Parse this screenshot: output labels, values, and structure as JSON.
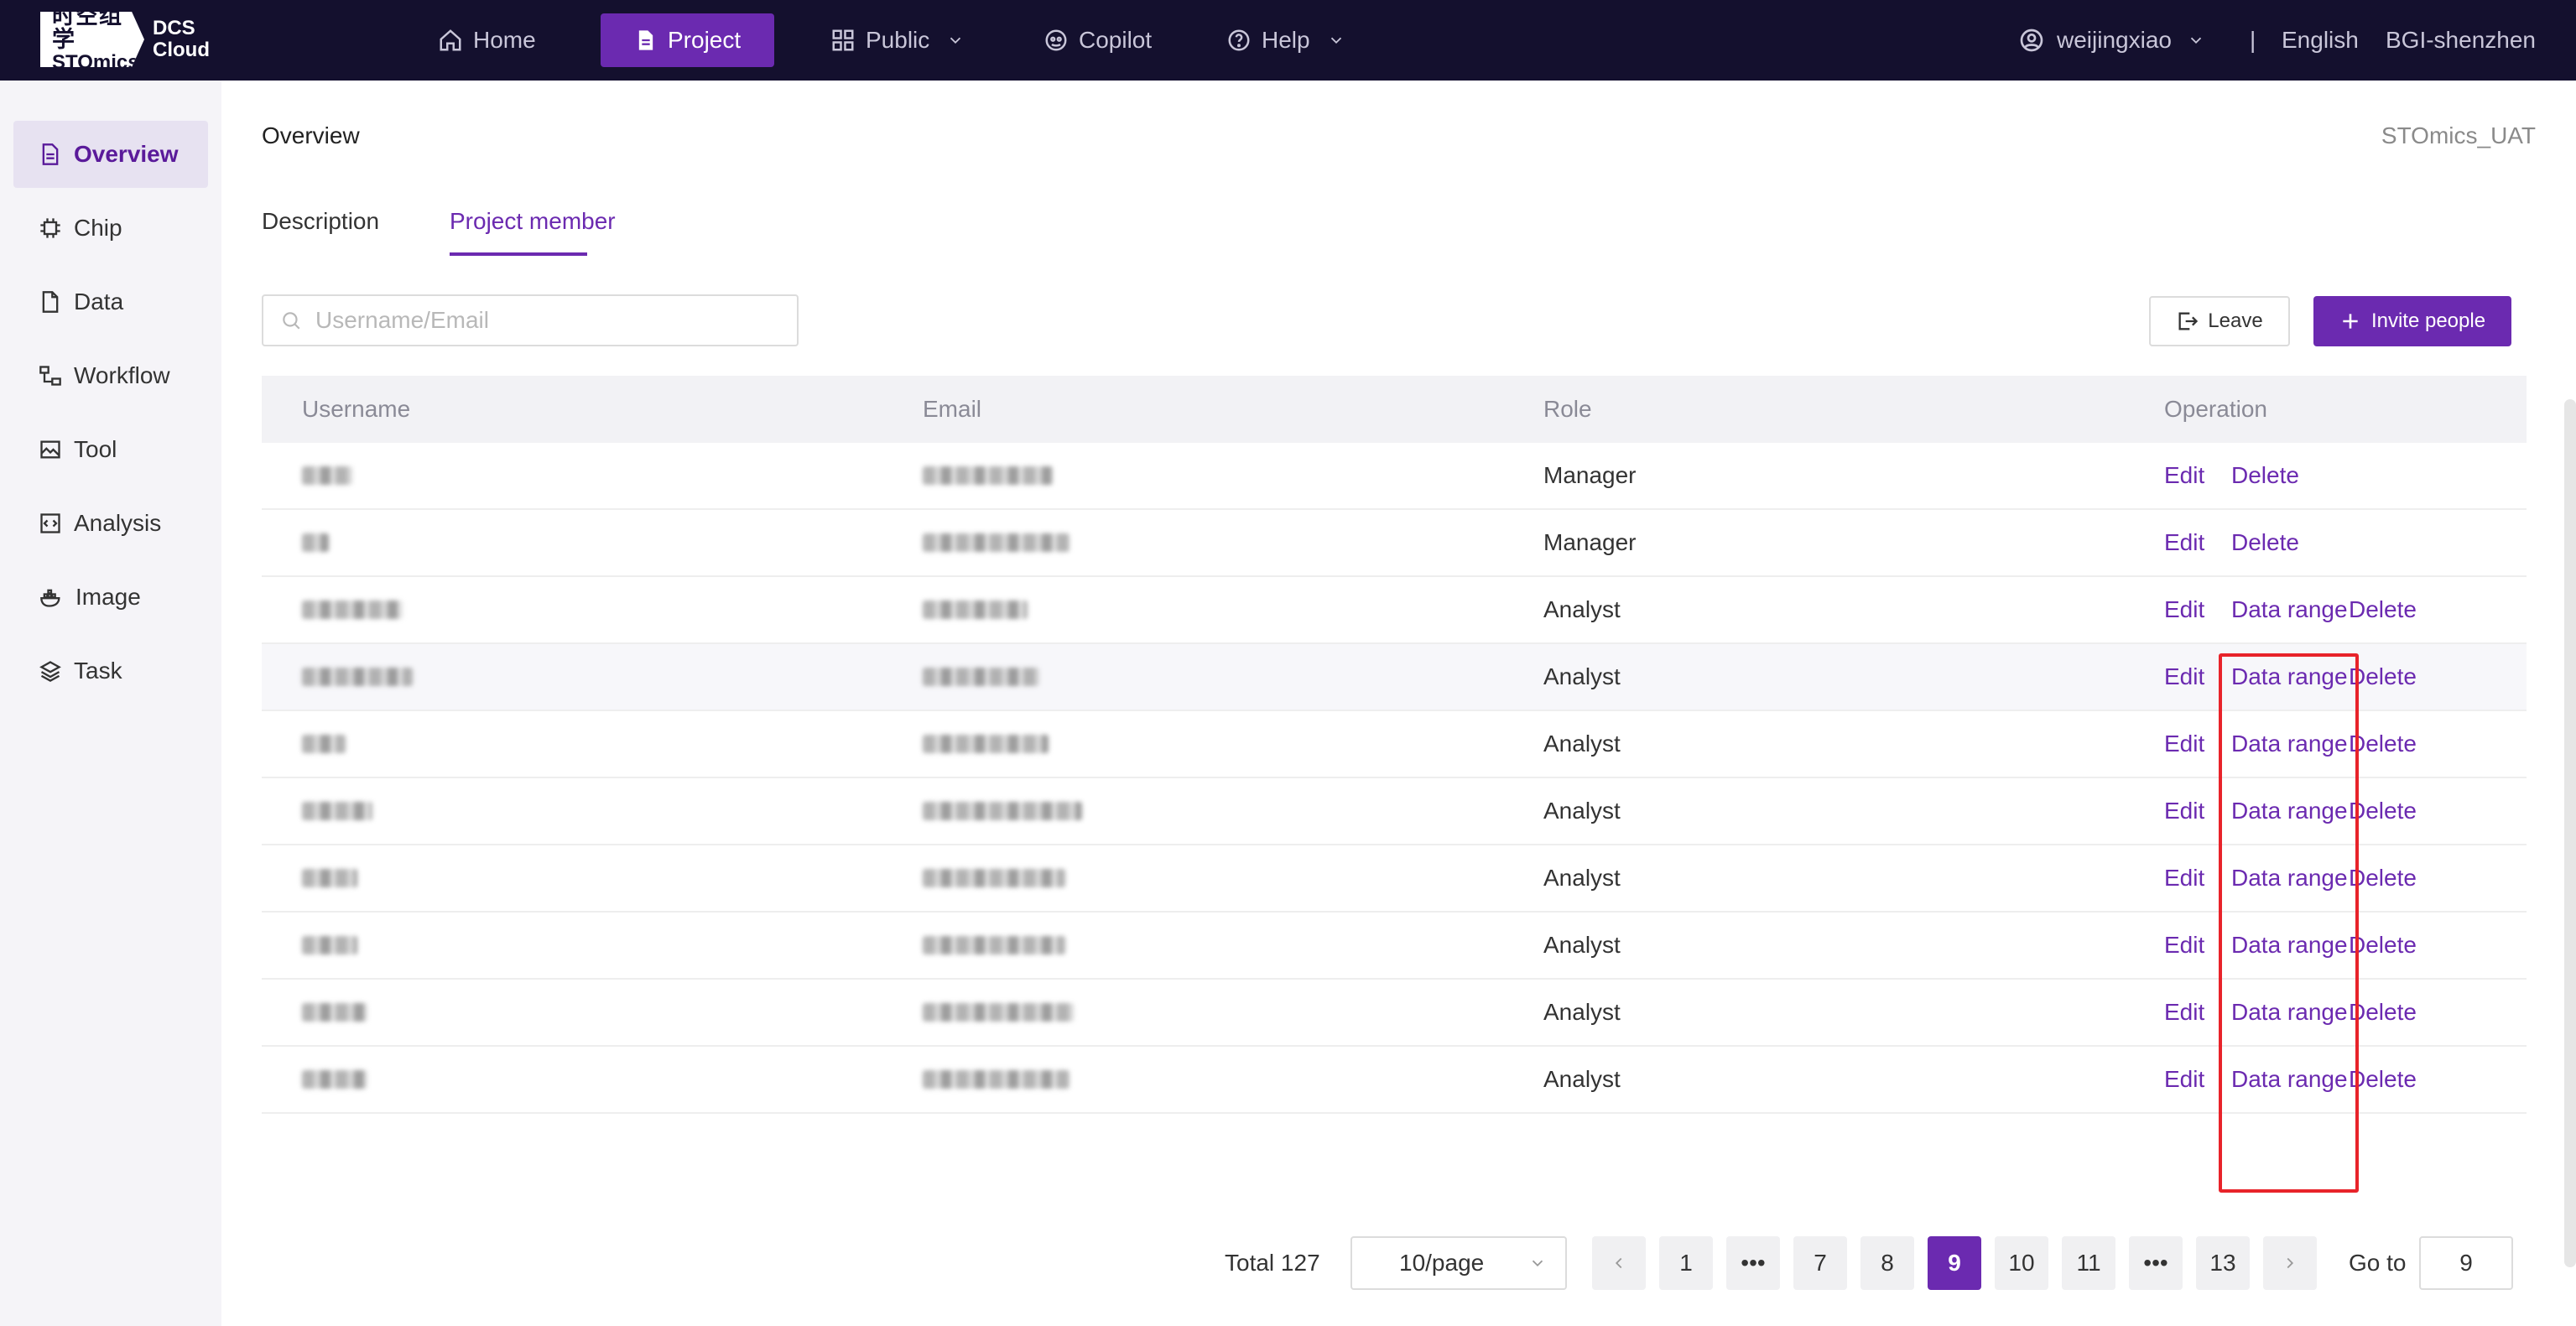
{
  "brand": {
    "logo_cn": "时空组学",
    "logo_en": "STOmics",
    "product_line1": "DCS",
    "product_line2": "Cloud"
  },
  "topnav": [
    {
      "label": "Home",
      "icon": "home-icon"
    },
    {
      "label": "Project",
      "icon": "document-icon",
      "active": true
    },
    {
      "label": "Public",
      "icon": "grid-icon",
      "dropdown": true
    },
    {
      "label": "Copilot",
      "icon": "copilot-icon"
    },
    {
      "label": "Help",
      "icon": "help-icon",
      "dropdown": true
    }
  ],
  "user": {
    "name": "weijingxiao",
    "language": "English",
    "region": "BGI-shenzhen"
  },
  "sidebar": {
    "items": [
      {
        "label": "Overview",
        "icon": "document-icon",
        "active": true
      },
      {
        "label": "Chip",
        "icon": "chip-icon"
      },
      {
        "label": "Data",
        "icon": "file-icon"
      },
      {
        "label": "Workflow",
        "icon": "workflow-icon"
      },
      {
        "label": "Tool",
        "icon": "image-icon"
      },
      {
        "label": "Analysis",
        "icon": "code-icon"
      },
      {
        "label": "Image",
        "icon": "docker-icon"
      },
      {
        "label": "Task",
        "icon": "layers-icon"
      }
    ]
  },
  "page": {
    "breadcrumb": "Overview",
    "tenant": "STOmics_UAT"
  },
  "tabs": [
    {
      "label": "Description"
    },
    {
      "label": "Project member",
      "active": true
    }
  ],
  "search": {
    "placeholder": "Username/Email",
    "value": ""
  },
  "actions": {
    "leave_label": "Leave",
    "invite_label": "Invite people"
  },
  "table": {
    "headers": {
      "username": "Username",
      "email": "Email",
      "role": "Role",
      "operation": "Operation"
    },
    "op_labels": {
      "edit": "Edit",
      "data_range": "Data range",
      "delete": "Delete"
    },
    "rows": [
      {
        "role": "Manager"
      },
      {
        "role": "Manager"
      },
      {
        "role": "Analyst"
      },
      {
        "role": "Analyst"
      },
      {
        "role": "Analyst"
      },
      {
        "role": "Analyst"
      },
      {
        "role": "Analyst"
      },
      {
        "role": "Analyst"
      },
      {
        "role": "Analyst"
      },
      {
        "role": "Analyst"
      }
    ]
  },
  "pagination": {
    "total_label": "Total 127",
    "page_size": "10/page",
    "pages": [
      "1",
      "•••",
      "7",
      "8",
      "9",
      "10",
      "11",
      "•••",
      "13"
    ],
    "current": "9",
    "goto_label": "Go to",
    "goto_value": "9"
  },
  "colors": {
    "accent": "#6b2ab0",
    "topbar": "#14102e",
    "highlight": "#e8232a"
  }
}
